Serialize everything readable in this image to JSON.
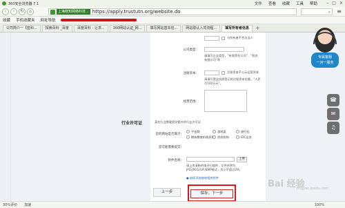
{
  "browser": {
    "title": "360安全浏览器 7.1",
    "menus": [
      "文件",
      "查看",
      "收藏",
      "工具",
      "帮助"
    ],
    "site_badge": "上海晓知网络科技...",
    "url": "https://apply.trustutn.org/website.do",
    "bookmarks": [
      "收藏",
      "手机收藏夹",
      "网址导航"
    ],
    "tabs": [
      "公司简介一【蓝科...",
      "探索百科 _百度",
      "百度百科 - 让求...",
      "360网站认证_网...",
      "填写网站基本信...",
      "网站取认入驾流程...",
      "填写所有者信息"
    ],
    "active_tab_index": 6,
    "new_tab_icon": "plus-icon"
  },
  "form": {
    "checkbox_label": "运营机构与所有者不合法法人",
    "checkbox_label2": "与所有者不合法法人",
    "company_type_label": "公司类型：",
    "company_type_hint": "请填写企业类型，“有限责任公司”、“股份有限公司”等",
    "registered_capital_label": "注册资本：",
    "registered_capital_check": "注册资本不公示运营资本",
    "registered_capital_hint": "请填写营业执照登记的注册资本金额，“人民币500万元”。",
    "business_scope_label": "经营范围：",
    "section_title": "行业许可证",
    "section_note": "某些行业需要提交额外的行业许可证",
    "industry_label": "您的网站是否属于：",
    "industry_options": [
      "平台商",
      "游戏类",
      "旅行社",
      "拥有教育机构资格",
      "资质机构",
      "IDC业务"
    ],
    "license_label": "您可能需要提交：",
    "attachment_label": "附件名称：",
    "upload_label": "上传",
    "upload_hint": "请上传清晰的电子扫描件，文件名称为JPG/JPEG/GIF/BMP格式，大小不超过2M。",
    "attach_link": "● 继续添加其他相关附件",
    "prev_button": "上一步",
    "next_button": "保存，下一步"
  },
  "service": {
    "button_text_1": "专属客服",
    "button_text_2": "一对一服务"
  },
  "side_icons": [
    "phone-icon",
    "chat-icon",
    "headset-icon"
  ],
  "watermark": {
    "main": "Bai 经验",
    "sub": "jingyan.baidu.com"
  },
  "status": {
    "left": "30%评价",
    "mid": "加速",
    "right": "100%"
  }
}
